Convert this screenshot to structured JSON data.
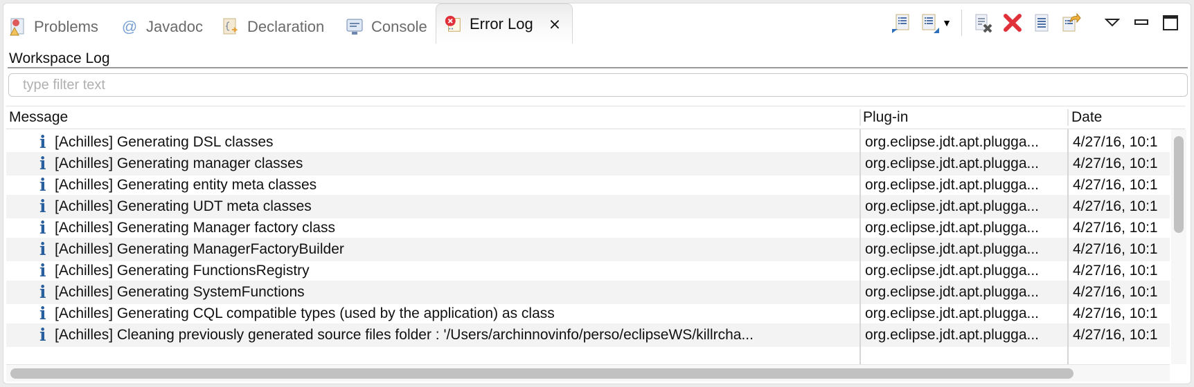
{
  "tabs": [
    {
      "label": "Problems",
      "icon": "problems-icon",
      "active": false
    },
    {
      "label": "Javadoc",
      "icon": "javadoc-icon",
      "active": false
    },
    {
      "label": "Declaration",
      "icon": "declaration-icon",
      "active": false
    },
    {
      "label": "Console",
      "icon": "console-icon",
      "active": false
    },
    {
      "label": "Error Log",
      "icon": "error-log-icon",
      "active": true,
      "close_icon": "close-icon"
    }
  ],
  "toolbar": {
    "buttons": [
      "import-log-icon",
      "export-log-icon",
      "dropdown-icon",
      "clear-log-icon",
      "delete-log-icon",
      "open-log-icon",
      "restore-log-icon"
    ],
    "view_menu": "view-menu-icon",
    "minimize": "minimize-icon",
    "maximize": "maximize-icon"
  },
  "section_title": "Workspace Log",
  "filter": {
    "value": "",
    "placeholder": "type filter text"
  },
  "table": {
    "columns": [
      "Message",
      "Plug-in",
      "Date"
    ],
    "rows": [
      {
        "icon": "info-icon",
        "message": "[Achilles] Generating DSL classes",
        "plugin": "org.eclipse.jdt.apt.plugga...",
        "date": "4/27/16, 10:1"
      },
      {
        "icon": "info-icon",
        "message": "[Achilles] Generating manager classes",
        "plugin": "org.eclipse.jdt.apt.plugga...",
        "date": "4/27/16, 10:1"
      },
      {
        "icon": "info-icon",
        "message": "[Achilles] Generating entity meta classes",
        "plugin": "org.eclipse.jdt.apt.plugga...",
        "date": "4/27/16, 10:1"
      },
      {
        "icon": "info-icon",
        "message": "[Achilles] Generating UDT meta classes",
        "plugin": "org.eclipse.jdt.apt.plugga...",
        "date": "4/27/16, 10:1"
      },
      {
        "icon": "info-icon",
        "message": "[Achilles] Generating Manager factory class",
        "plugin": "org.eclipse.jdt.apt.plugga...",
        "date": "4/27/16, 10:1"
      },
      {
        "icon": "info-icon",
        "message": "[Achilles] Generating ManagerFactoryBuilder",
        "plugin": "org.eclipse.jdt.apt.plugga...",
        "date": "4/27/16, 10:1"
      },
      {
        "icon": "info-icon",
        "message": "[Achilles] Generating FunctionsRegistry",
        "plugin": "org.eclipse.jdt.apt.plugga...",
        "date": "4/27/16, 10:1"
      },
      {
        "icon": "info-icon",
        "message": "[Achilles] Generating SystemFunctions",
        "plugin": "org.eclipse.jdt.apt.plugga...",
        "date": "4/27/16, 10:1"
      },
      {
        "icon": "info-icon",
        "message": "[Achilles] Generating CQL compatible types (used by the application) as class",
        "plugin": "org.eclipse.jdt.apt.plugga...",
        "date": "4/27/16, 10:1"
      },
      {
        "icon": "info-icon",
        "message": "[Achilles] Cleaning previously generated source files folder : '/Users/archinnovinfo/perso/eclipseWS/killrcha...",
        "plugin": "org.eclipse.jdt.apt.plugga...",
        "date": "4/27/16, 10:1"
      }
    ]
  },
  "colors": {
    "info": "#2a5f9e",
    "delete": "#e0313a",
    "alt_row": "#f3f3f3"
  }
}
